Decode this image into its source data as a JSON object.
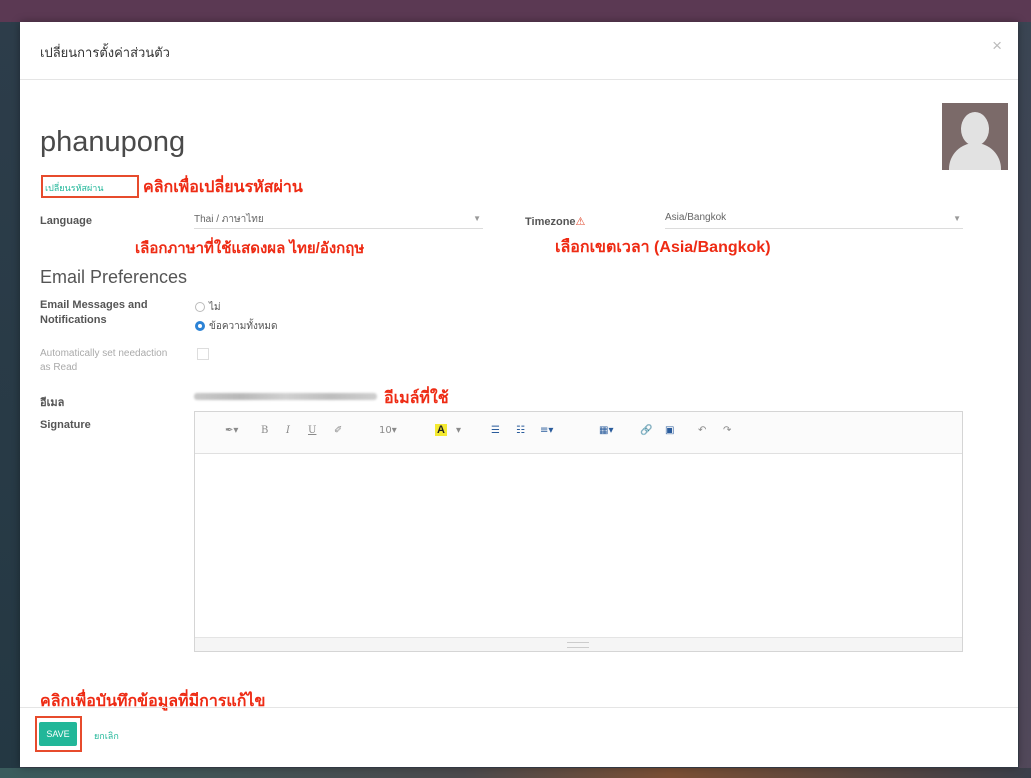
{
  "dialog": {
    "title": "เปลี่ยนการตั้งค่าส่วนตัว",
    "close_icon": "×"
  },
  "user": {
    "name": "phanupong",
    "change_password_label": "เปลี่ยนรหัสผ่าน"
  },
  "fields": {
    "language": {
      "label": "Language",
      "value": "Thai / ภาษาไทย"
    },
    "timezone": {
      "label": "Timezone",
      "warning_icon": "⚠",
      "value": "Asia/Bangkok"
    },
    "email_section_title": "Email Preferences",
    "email_messages": {
      "label": "Email Messages and Notifications",
      "options": [
        {
          "label": "ไม่",
          "checked": false
        },
        {
          "label": "ข้อความทั้งหมด",
          "checked": true
        }
      ]
    },
    "auto_read": {
      "label": "Automatically set needaction as Read",
      "checked": false
    },
    "email": {
      "label": "อีเมล"
    },
    "signature": {
      "label": "Signature"
    }
  },
  "editor_toolbar": {
    "pen": "✒▾",
    "bold": "B",
    "italic": "I",
    "underline": "U",
    "eraser": "✐",
    "font_size": "10▾",
    "font_color": "A",
    "font_color_caret": "▾",
    "ul": "☰",
    "ol": "☷",
    "align": "≡▾",
    "table": "▦▾",
    "link": "🔗",
    "image": "▣",
    "undo": "↶",
    "redo": "↷"
  },
  "annotations": {
    "change_password": "คลิกเพื่อเปลี่ยนรหัสผ่าน",
    "language": "เลือกภาษาที่ใช้แสดงผล ไทย/อังกฤษ",
    "timezone": "เลือกเขตเวลา (Asia/Bangkok)",
    "email": "อีเมล์ที่ใช้",
    "save": "คลิกเพื่อบันทึกข้อมูลที่มีการแก้ไข"
  },
  "footer": {
    "save_label": "SAVE",
    "cancel_label": "ยกเลิก"
  },
  "colors": {
    "accent": "#21b799",
    "annotation": "#ee2b14",
    "radio_checked": "#2c83d6"
  }
}
